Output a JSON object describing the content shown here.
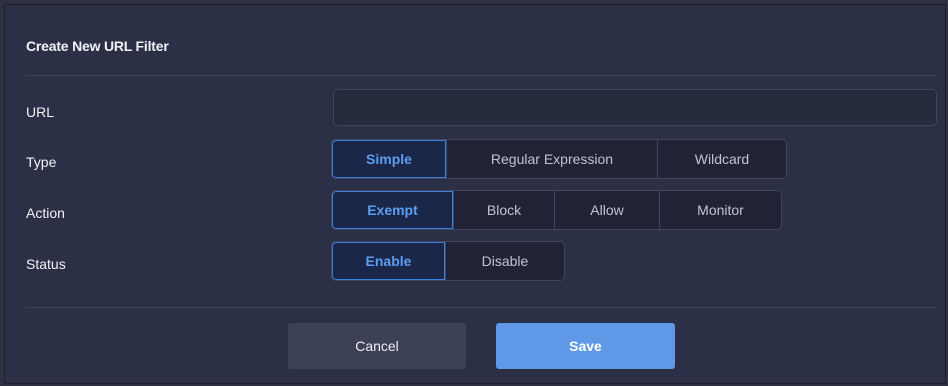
{
  "dialog": {
    "title": "Create New URL Filter"
  },
  "form": {
    "url": {
      "label": "URL",
      "value": "",
      "placeholder": ""
    },
    "type": {
      "label": "Type",
      "options": [
        "Simple",
        "Regular Expression",
        "Wildcard"
      ],
      "selected": "Simple"
    },
    "action": {
      "label": "Action",
      "options": [
        "Exempt",
        "Block",
        "Allow",
        "Monitor"
      ],
      "selected": "Exempt"
    },
    "status": {
      "label": "Status",
      "options": [
        "Enable",
        "Disable"
      ],
      "selected": "Enable"
    }
  },
  "buttons": {
    "cancel": "Cancel",
    "save": "Save"
  },
  "colors": {
    "background": "#2b3046",
    "accent": "#5e98e6",
    "selected_text": "#5b9ef0",
    "cancel_button": "#3c4156"
  }
}
